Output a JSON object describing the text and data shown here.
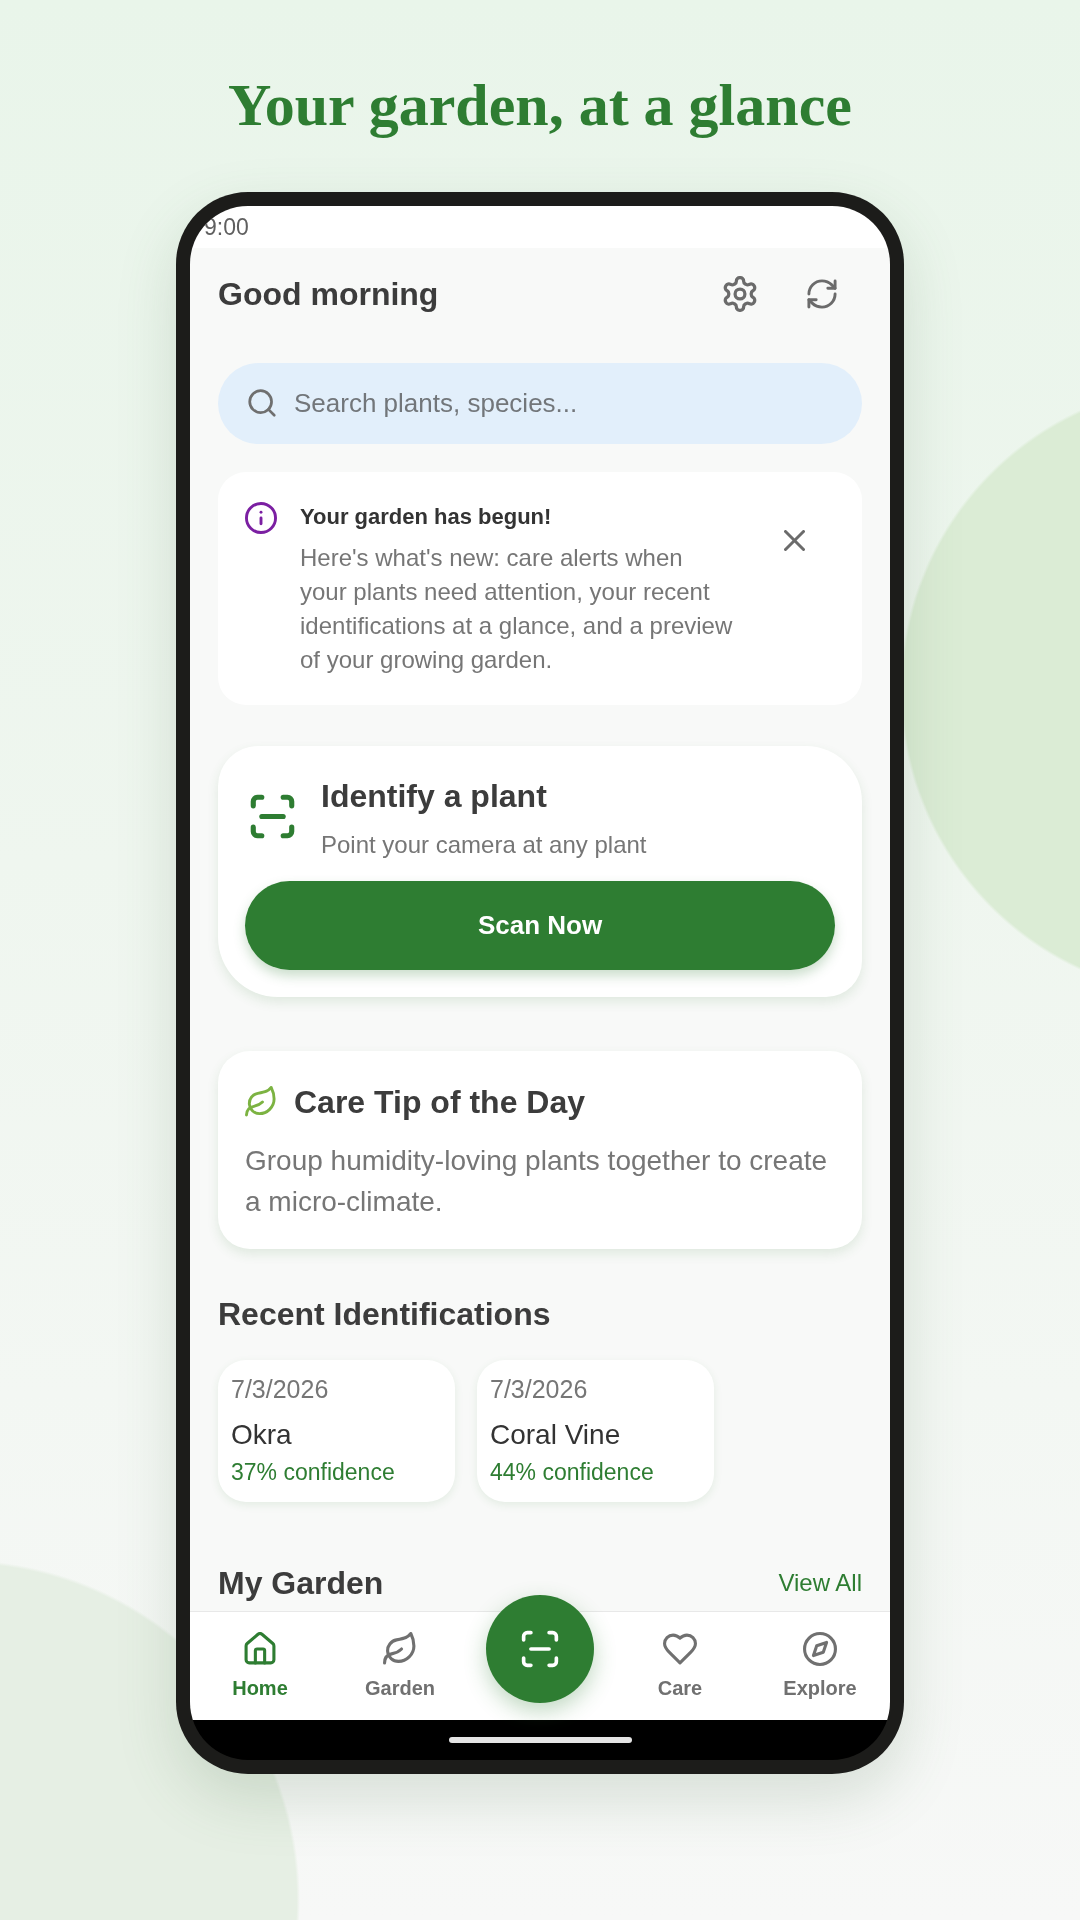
{
  "headline": "Your garden, at a glance",
  "status_bar": {
    "time": "9:00"
  },
  "header": {
    "greeting": "Good morning"
  },
  "search": {
    "placeholder": "Search plants, species..."
  },
  "notice": {
    "title": "Your garden has begun!",
    "body": "Here's what's new: care alerts when your plants need attention, your recent identifications at a glance, and a preview of your growing garden."
  },
  "identify_card": {
    "title": "Identify a plant",
    "subtitle": "Point your camera at any plant",
    "button": "Scan Now"
  },
  "care_tip": {
    "title": "Care Tip of the Day",
    "body": "Group humidity-loving plants together to create a micro-climate."
  },
  "recent_identifications": {
    "title": "Recent Identifications",
    "items": [
      {
        "date": "7/3/2026",
        "name": "Okra",
        "confidence": "37% confidence"
      },
      {
        "date": "7/3/2026",
        "name": "Coral Vine",
        "confidence": "44% confidence"
      }
    ]
  },
  "my_garden": {
    "title": "My Garden",
    "link": "View All"
  },
  "bottom_nav": {
    "items": [
      {
        "label": "Home",
        "selected": true
      },
      {
        "label": "Garden",
        "selected": false
      },
      {
        "label": "Care",
        "selected": false
      },
      {
        "label": "Explore",
        "selected": false
      }
    ]
  }
}
